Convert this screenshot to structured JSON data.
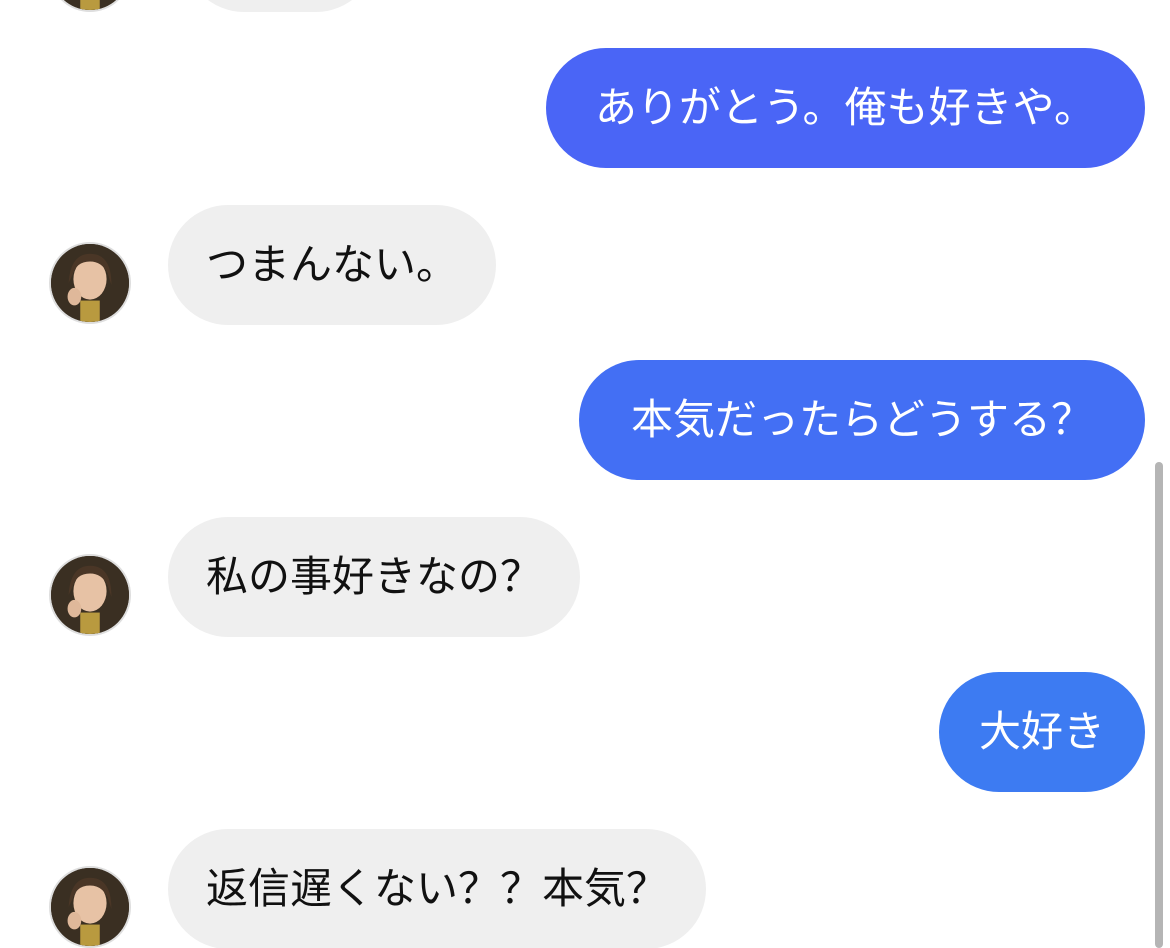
{
  "colors": {
    "sent_bubble_top": "#4a65f6",
    "sent_bubble_mid": "#436ff4",
    "sent_bubble_bottom": "#3d7bf2",
    "received_bubble": "#efefef",
    "received_text": "#111111",
    "sent_text": "#ffffff",
    "scrollbar": "#b5b5b5"
  },
  "conversation": {
    "messages": [
      {
        "sender": "other",
        "text": ""
      },
      {
        "sender": "me",
        "text": "ありがとう。俺も好きや。"
      },
      {
        "sender": "other",
        "text": "つまんない。"
      },
      {
        "sender": "me",
        "text": "本気だったらどうする？"
      },
      {
        "sender": "other",
        "text": "私の事好きなの？"
      },
      {
        "sender": "me",
        "text": "大好き"
      },
      {
        "sender": "other",
        "text": "返信遅くない？？本気？"
      }
    ]
  }
}
